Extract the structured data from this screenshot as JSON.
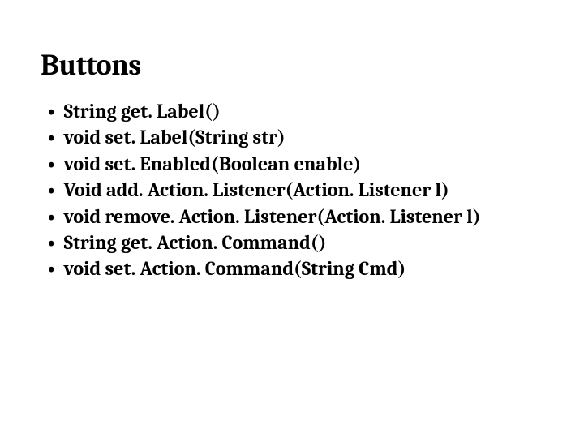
{
  "title": "Buttons",
  "bullets": [
    "String get. Label()",
    "void set. Label(String str)",
    "void set. Enabled(Boolean enable)",
    "Void add. Action. Listener(Action. Listener l)",
    "void remove. Action. Listener(Action. Listener l)",
    "String get. Action. Command()",
    "void set. Action. Command(String Cmd)"
  ]
}
